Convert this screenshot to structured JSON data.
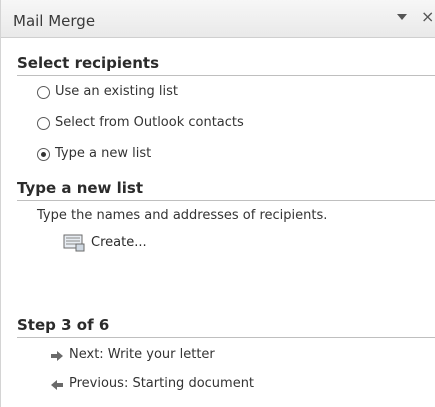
{
  "pane": {
    "title": "Mail Merge",
    "dropdown_icon": "chevron-down-icon",
    "close_glyph": "×"
  },
  "select_recipients": {
    "heading": "Select recipients",
    "options": [
      {
        "label": "Use an existing list",
        "checked": false
      },
      {
        "label": "Select from Outlook contacts",
        "checked": false
      },
      {
        "label": "Type a new list",
        "checked": true
      }
    ]
  },
  "type_new_list": {
    "heading": "Type a new list",
    "description": "Type the names and addresses of recipients.",
    "create_label": "Create...",
    "create_icon": "create-list-icon"
  },
  "step": {
    "heading": "Step 3 of 6",
    "next_label": "Next: Write your letter",
    "previous_label": "Previous: Starting document"
  },
  "colors": {
    "title_bar": "#ececec",
    "divider": "#bfbfbf",
    "text": "#2b2b2b"
  }
}
